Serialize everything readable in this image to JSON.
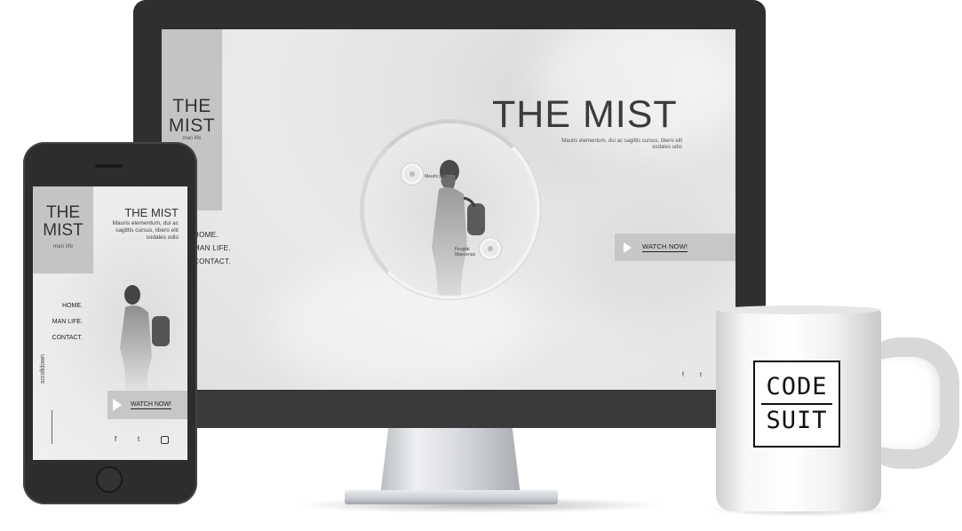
{
  "monitor": {
    "logo": {
      "line1": "THE",
      "line2": "MIST",
      "sub": "man life"
    },
    "nav": [
      "HOME.",
      "MAN LIFE.",
      "CONTACT."
    ],
    "hero_title": "THE MIST",
    "hero_sub": "Mauris elementum, dui ac sagittis cursus, libero elit sodales odio",
    "hotspots": [
      {
        "label": "Mauris pur..."
      },
      {
        "label": "Feugiat Maecenas"
      }
    ],
    "cta": "WATCH NOW!",
    "social": {
      "facebook": "f",
      "twitter": "t"
    }
  },
  "phone": {
    "logo": {
      "line1": "THE",
      "line2": "MIST",
      "sub": "man life"
    },
    "title": "THE MIST",
    "sub": "Mauris elementum, dui ac sagittis cursus, libero elit sodales odio",
    "nav": [
      "HOME.",
      "MAN LIFE.",
      "CONTACT."
    ],
    "scroll": "scrolldown",
    "cta": "WATCH NOW!",
    "social": [
      "f",
      "t",
      "ig"
    ]
  },
  "mug": {
    "line1": "CODE",
    "line2": "SUIT"
  },
  "colors": {
    "frame": "#2f2f2f",
    "screen_bg": "#e6e6e6",
    "block": "#c4c4c4",
    "text": "#333333"
  }
}
